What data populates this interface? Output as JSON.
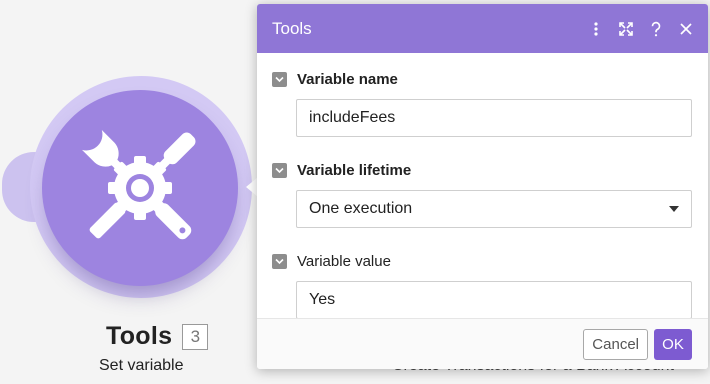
{
  "module": {
    "title": "Tools",
    "badge": "3",
    "subtitle": "Set variable",
    "background_label": "Create Transactions for a Bank Account",
    "icon": "tools-icon"
  },
  "dialog": {
    "title": "Tools",
    "header_icons": [
      "more-vertical-icon",
      "expand-icon",
      "help-icon",
      "close-icon"
    ],
    "fields": [
      {
        "label": "Variable name",
        "value": "includeFees"
      },
      {
        "label": "Variable lifetime",
        "value": "One execution"
      },
      {
        "label": "Variable value",
        "value": "Yes"
      }
    ],
    "cancel_label": "Cancel",
    "ok_label": "OK"
  },
  "colors": {
    "accent": "#8f76d6",
    "module_fill": "#9d84e0",
    "ok_button": "#7d5bd1"
  }
}
